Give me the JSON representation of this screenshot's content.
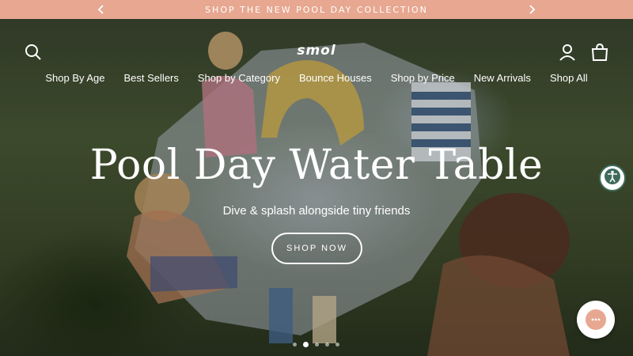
{
  "announcement": {
    "text": "SHOP THE NEW POOL DAY COLLECTION",
    "prev_icon": "chevron-left-icon",
    "next_icon": "chevron-right-icon",
    "background": "#e7a790"
  },
  "header": {
    "logo_text": "smol",
    "search_icon": "search-icon",
    "account_icon": "account-icon",
    "cart_icon": "cart-icon"
  },
  "nav": {
    "items": [
      {
        "label": "Shop By Age"
      },
      {
        "label": "Best Sellers"
      },
      {
        "label": "Shop by Category"
      },
      {
        "label": "Bounce Houses"
      },
      {
        "label": "Shop by Price"
      },
      {
        "label": "New Arrivals"
      },
      {
        "label": "Shop All"
      }
    ]
  },
  "hero": {
    "title": "Pool Day Water Table",
    "subtitle": "Dive & splash alongside tiny friends",
    "cta_label": "SHOP NOW",
    "slides_total": 5,
    "active_slide": 2
  },
  "widgets": {
    "accessibility_icon": "accessibility-icon",
    "chat_icon": "chat-icon",
    "accent": "#3e6a5b"
  }
}
